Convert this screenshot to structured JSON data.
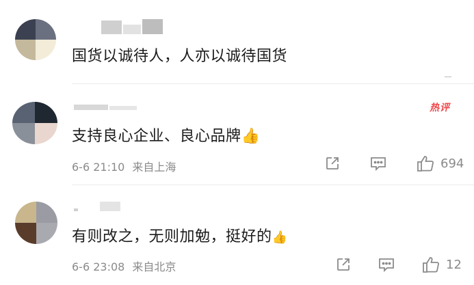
{
  "comments": [
    {
      "text": "国货以诚待人，人亦以诚待国货",
      "avatar_colors": [
        "#3b4150",
        "#6b7080",
        "#c4b99c",
        "#f2ecd9"
      ]
    },
    {
      "badge": "热评",
      "text": "支持良心企业、良心品牌",
      "emoji": "👍",
      "time": "6-6 21:10",
      "location": "来自上海",
      "likes": "694",
      "avatar_colors": [
        "#596272",
        "#1f2830",
        "#8a9099",
        "#e8d6cf"
      ]
    },
    {
      "text": "有则改之，无则加勉，挺好的",
      "emoji": "👍",
      "time": "6-6 23:08",
      "location": "来自北京",
      "likes": "12",
      "avatar_colors": [
        "#c9b68c",
        "#9b9ba3",
        "#5a3c2b",
        "#a9a9b0"
      ]
    }
  ],
  "colors": {
    "meta_gray": "#8a8a8a",
    "hot_red": "#f0484d",
    "divider": "#ececec"
  },
  "icons": [
    "share-icon",
    "comment-icon",
    "like-icon"
  ]
}
